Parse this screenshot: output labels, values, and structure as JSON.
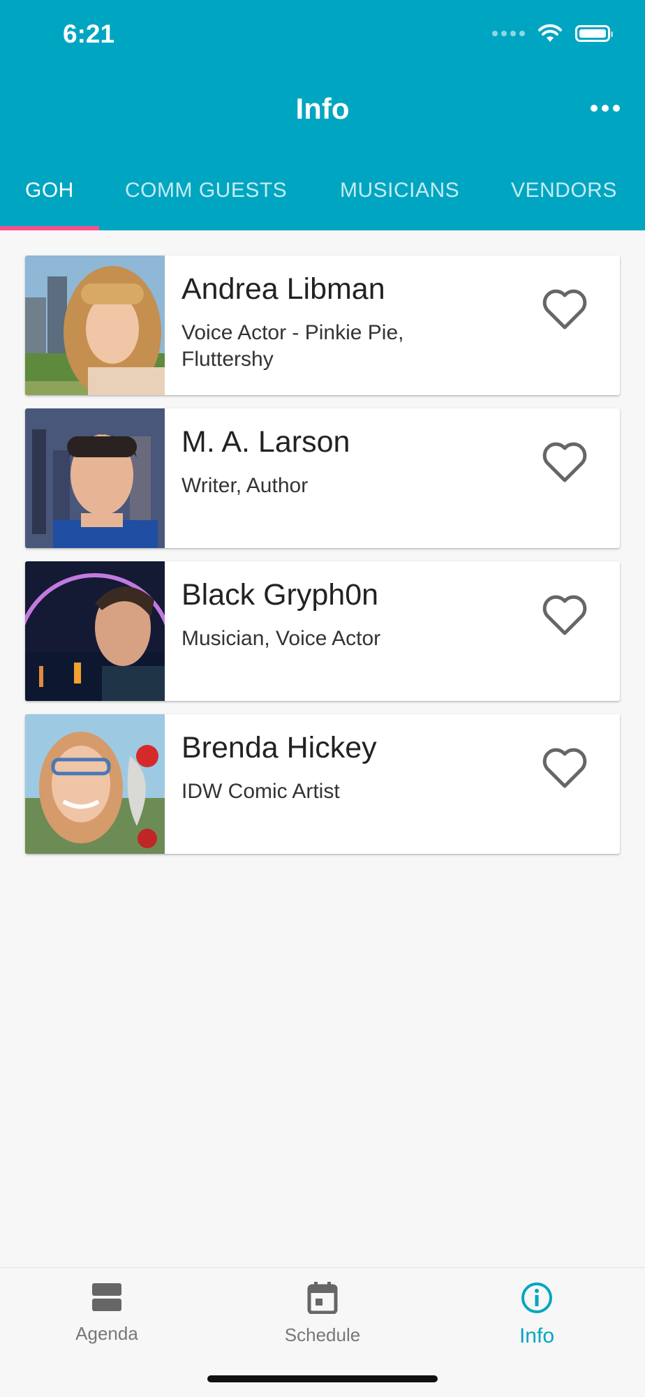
{
  "status": {
    "time": "6:21"
  },
  "header": {
    "title": "Info"
  },
  "tabs": [
    {
      "label": "GOH",
      "active": true
    },
    {
      "label": "COMM GUESTS",
      "active": false
    },
    {
      "label": "MUSICIANS",
      "active": false
    },
    {
      "label": "VENDORS",
      "active": false
    }
  ],
  "guests": [
    {
      "name": "Andrea Libman",
      "role": "Voice Actor - Pinkie Pie, Fluttershy",
      "favorited": false
    },
    {
      "name": "M. A. Larson",
      "role": "Writer, Author",
      "favorited": false
    },
    {
      "name": "Black Gryph0n",
      "role": "Musician, Voice Actor",
      "favorited": false
    },
    {
      "name": "Brenda Hickey",
      "role": "IDW Comic Artist",
      "favorited": false
    }
  ],
  "bottom_nav": [
    {
      "label": "Agenda",
      "icon": "agenda-icon",
      "active": false
    },
    {
      "label": "Schedule",
      "icon": "calendar-icon",
      "active": false
    },
    {
      "label": "Info",
      "icon": "info-icon",
      "active": true
    }
  ],
  "colors": {
    "primary": "#00a6c1",
    "indicator": "#ff4f8b",
    "background": "#f7f7f7"
  }
}
